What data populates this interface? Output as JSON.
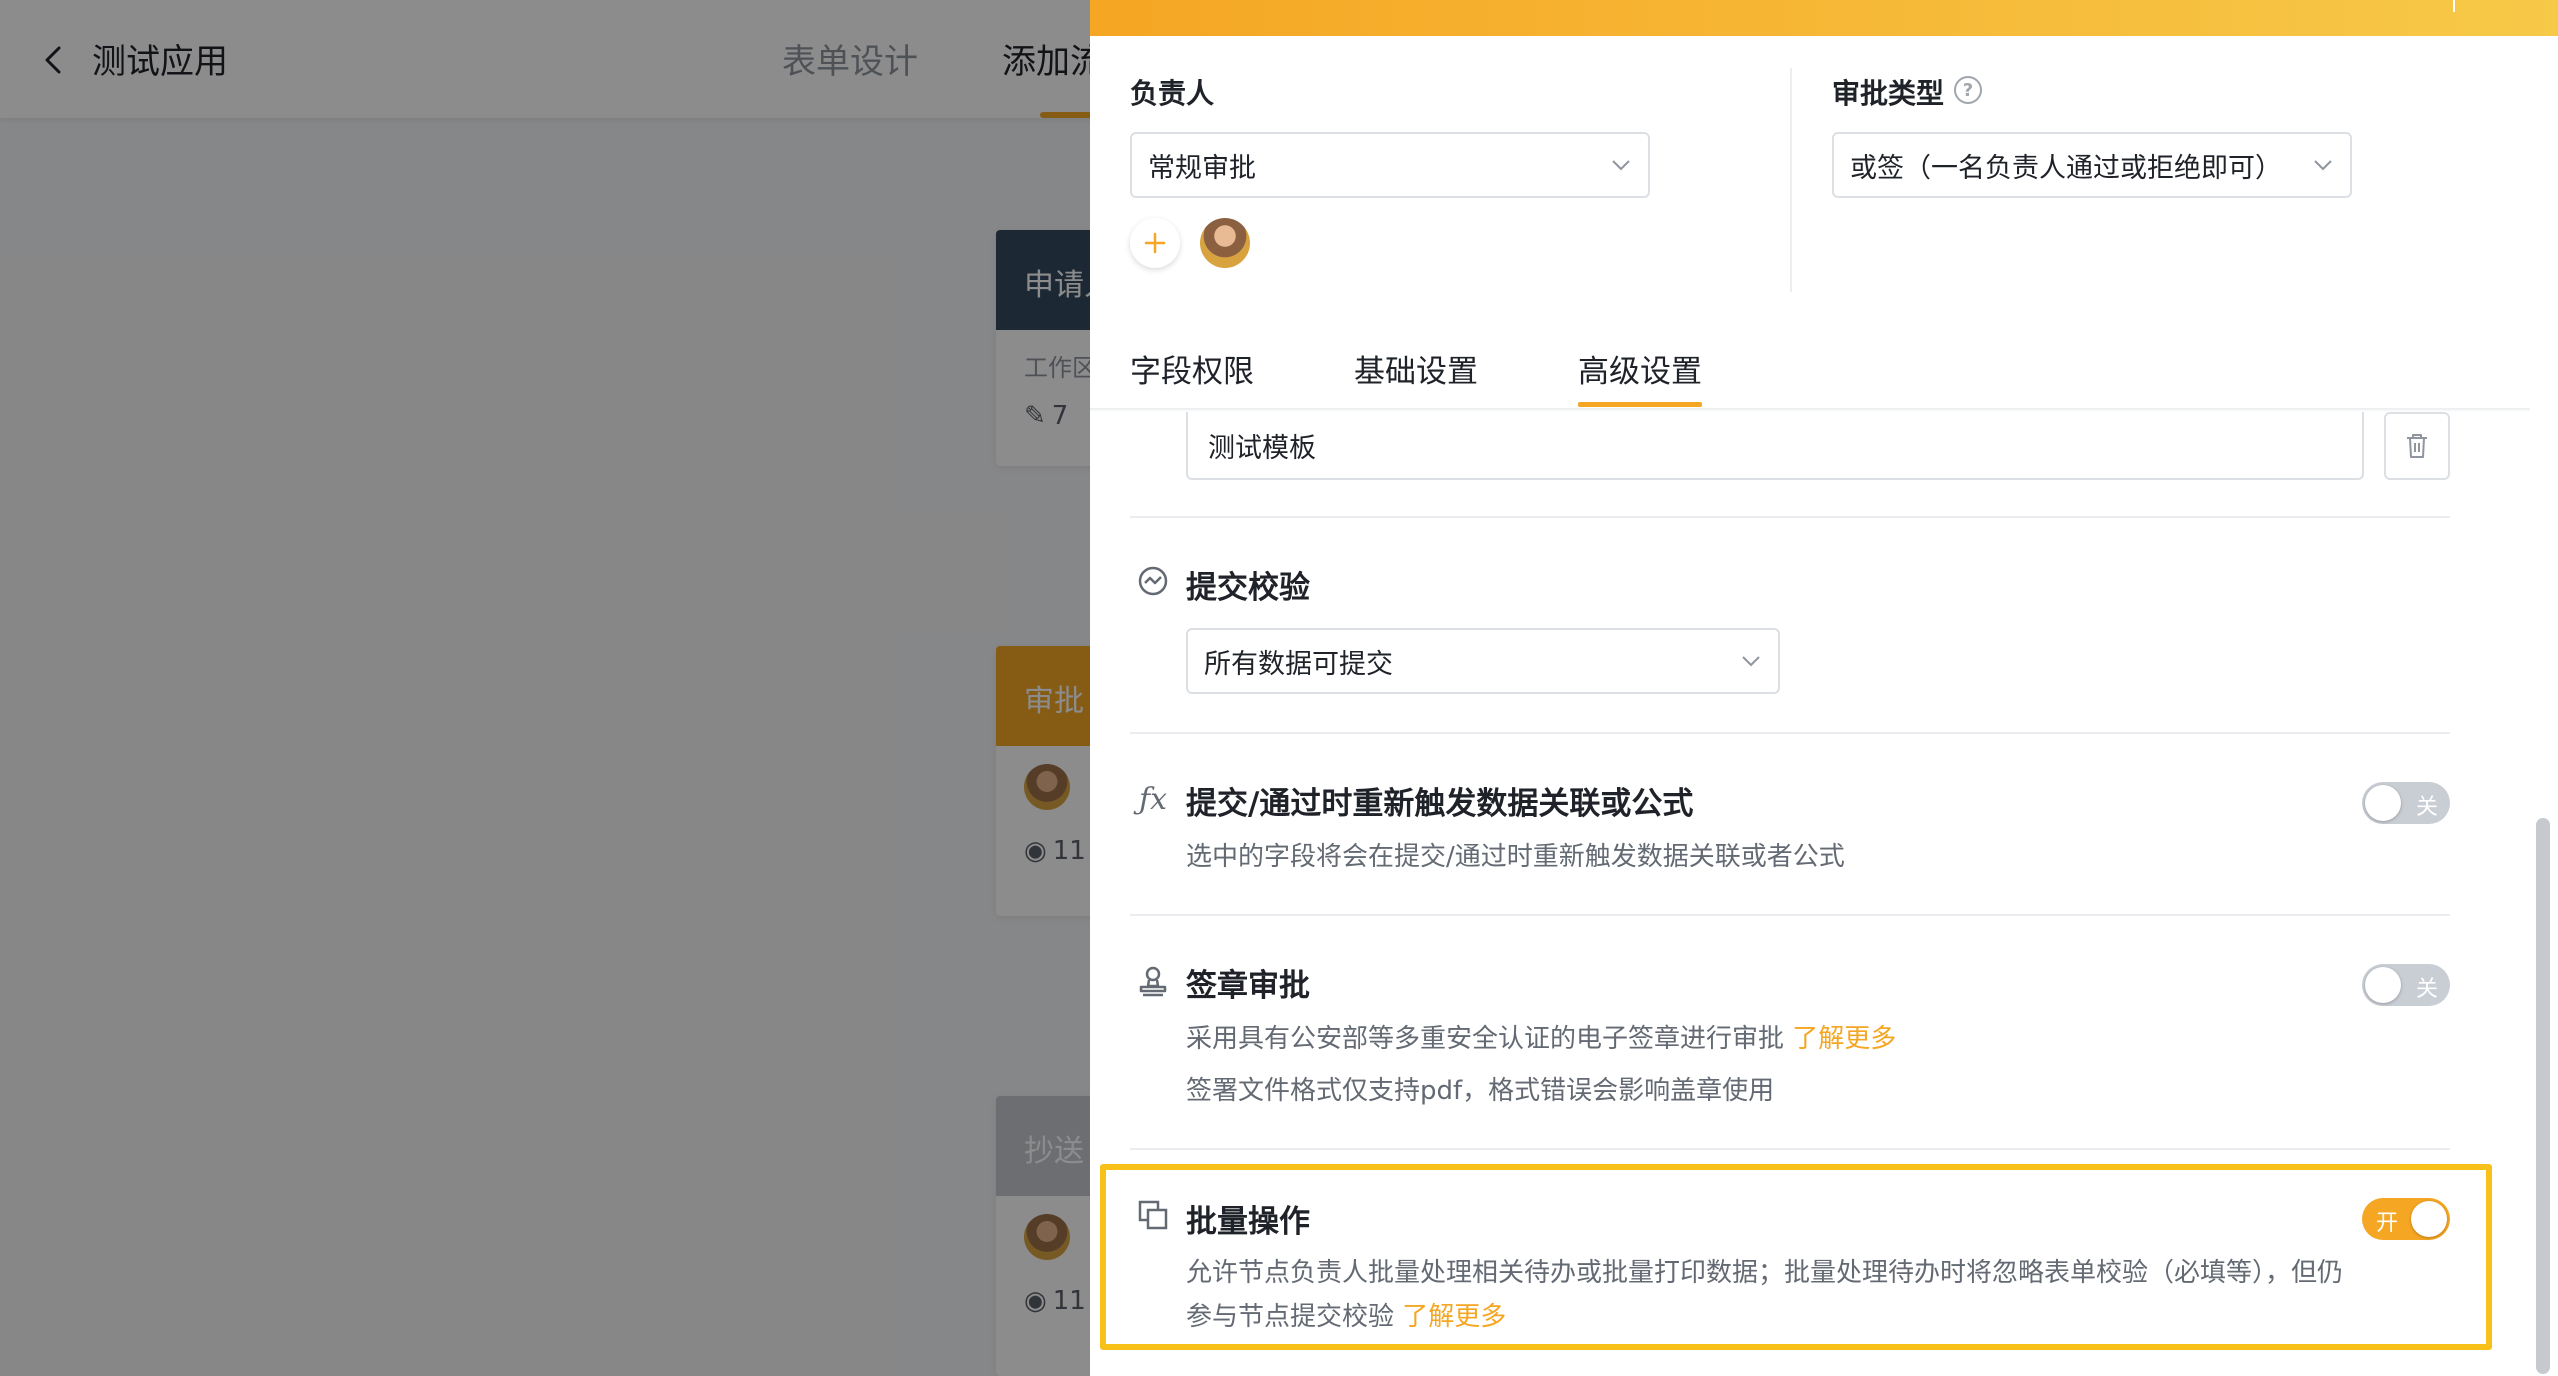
{
  "header": {
    "app_title": "测试应用",
    "tabs": [
      {
        "label": "表单设计"
      },
      {
        "label": "添加流"
      }
    ]
  },
  "flow_cards": [
    {
      "title": "申请人",
      "line1": "工作区",
      "line2": "7"
    },
    {
      "title": "审批",
      "line2": "11"
    },
    {
      "title": "抄送",
      "line2": "11"
    }
  ],
  "drawer": {
    "owner": {
      "label": "负责人",
      "select_value": "常规审批"
    },
    "approval_type": {
      "label": "审批类型",
      "select_value": "或签（一名负责人通过或拒绝即可）"
    },
    "sub_tabs": [
      {
        "label": "字段权限"
      },
      {
        "label": "基础设置"
      },
      {
        "label": "高级设置",
        "active": true
      }
    ],
    "template_value": "测试模板",
    "submit_check": {
      "title": "提交校验",
      "select_value": "所有数据可提交"
    },
    "retrigger": {
      "title": "提交/通过时重新触发数据关联或公式",
      "desc": "选中的字段将会在提交/通过时重新触发数据关联或者公式",
      "toggle_label": "关",
      "enabled": false
    },
    "seal": {
      "title": "签章审批",
      "desc1": "采用具有公安部等多重安全认证的电子签章进行审批",
      "link": "了解更多",
      "desc2": "签署文件格式仅支持pdf，格式错误会影响盖章使用",
      "toggle_label": "关",
      "enabled": false
    },
    "batch": {
      "title": "批量操作",
      "desc1": "允许节点负责人批量处理相关待办或批量打印数据；批量处理待办时将忽略表单校验（必填等），但仍",
      "desc2": "参与节点提交校验",
      "link": "了解更多",
      "toggle_label": "开",
      "enabled": true
    }
  },
  "colors": {
    "accent": "#f5a623",
    "highlight": "#f7c11a",
    "apply_card": "#34495e",
    "cc_card": "#c5c9cf"
  }
}
